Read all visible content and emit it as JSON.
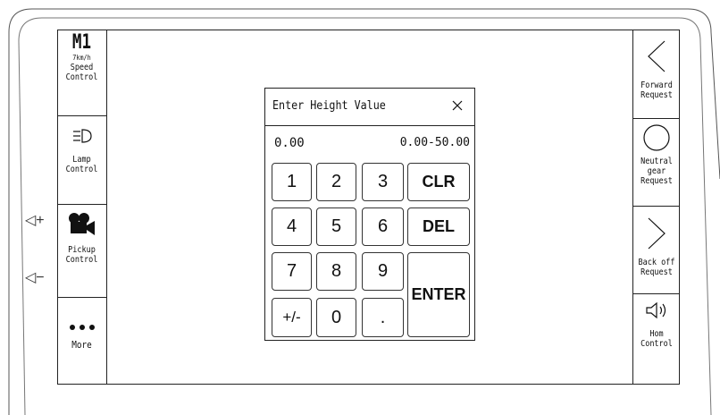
{
  "left_panel": {
    "speed": {
      "mode": "M1",
      "speed": "7km/h",
      "line1": "Speed",
      "line2": "Control"
    },
    "lamp": {
      "icon": "headlamp-icon",
      "line1": "Lamp",
      "line2": "Control"
    },
    "pickup": {
      "icon": "camera-icon",
      "line1": "Pickup",
      "line2": "Control"
    },
    "more": {
      "icon": "more-dots-icon",
      "label": "More"
    }
  },
  "right_panel": {
    "forward": {
      "icon": "chevron-left-icon",
      "line1": "Forward",
      "line2": "Request"
    },
    "neutral": {
      "icon": "circle-icon",
      "line1": "Neutral",
      "line2": "gear",
      "line3": "Request"
    },
    "backoff": {
      "icon": "chevron-right-icon",
      "line1": "Back off",
      "line2": "Request"
    },
    "horn": {
      "icon": "horn-icon",
      "line1": "Hom",
      "line2": "Control"
    }
  },
  "hardware": {
    "vol_up": "◁+",
    "vol_down": "◁−"
  },
  "dialog": {
    "title": "Enter Height Value",
    "value": "0.00",
    "range": "0.00-50.00",
    "keys": {
      "k1": "1",
      "k2": "2",
      "k3": "3",
      "k4": "4",
      "k5": "5",
      "k6": "6",
      "k7": "7",
      "k8": "8",
      "k9": "9",
      "sign": "+/-",
      "k0": "0",
      "dot": ".",
      "clr": "CLR",
      "del": "DEL",
      "enter": "ENTER"
    }
  }
}
